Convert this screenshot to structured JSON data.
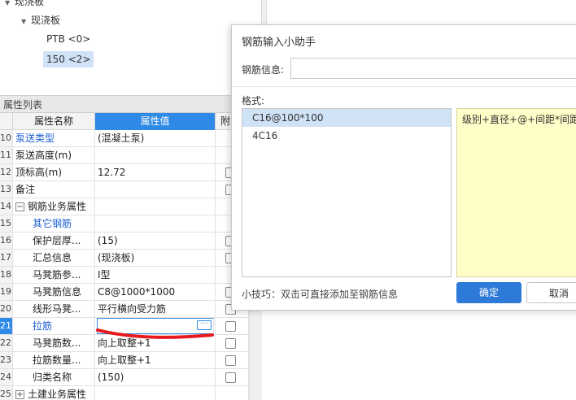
{
  "tree": {
    "items": [
      {
        "label": "现浇板",
        "expanded": true
      },
      {
        "label": "现浇板",
        "expanded": true
      },
      {
        "label": "PTB <0>"
      },
      {
        "label": "150 <2>",
        "selected": true
      }
    ]
  },
  "property_panel": {
    "title": "属性列表",
    "columns": [
      "属性名称",
      "属性值",
      "附"
    ],
    "rows": [
      {
        "num": "10",
        "name": "泵送类型",
        "value": "(混凝土泵)",
        "link": true,
        "check": false
      },
      {
        "num": "11",
        "name": "泵送高度(m)",
        "value": "",
        "check": false
      },
      {
        "num": "12",
        "name": "顶标高(m)",
        "value": "12.72",
        "check": true
      },
      {
        "num": "13",
        "name": "备注",
        "value": "",
        "check": true
      },
      {
        "num": "14",
        "name": "钢筋业务属性",
        "value": "",
        "group": true,
        "toggle": "−",
        "check": false
      },
      {
        "num": "15",
        "name": "其它钢筋",
        "value": "",
        "link": true,
        "check": false
      },
      {
        "num": "16",
        "name": "保护层厚...",
        "value": "(15)",
        "check": true
      },
      {
        "num": "17",
        "name": "汇总信息",
        "value": "(现浇板)",
        "check": true
      },
      {
        "num": "18",
        "name": "马凳筋参...",
        "value": "Ⅰ型",
        "check": false
      },
      {
        "num": "19",
        "name": "马凳筋信息",
        "value": "C8@1000*1000",
        "check": true
      },
      {
        "num": "20",
        "name": "线形马凳...",
        "value": "平行横向受力筋",
        "check": true
      },
      {
        "num": "21",
        "name": "拉筋",
        "value": "",
        "link": true,
        "active": true,
        "check": true
      },
      {
        "num": "22",
        "name": "马凳筋数...",
        "value": "向上取整+1",
        "check": true
      },
      {
        "num": "23",
        "name": "拉筋数量...",
        "value": "向上取整+1",
        "check": true
      },
      {
        "num": "24",
        "name": "归类名称",
        "value": "(150)",
        "check": true
      },
      {
        "num": "25",
        "name": "土建业务属性",
        "value": "",
        "group": true,
        "toggle": "+",
        "check": false
      }
    ],
    "edit_button_label": "···"
  },
  "dialog": {
    "title": "钢筋输入小助手",
    "info_label": "钢筋信息:",
    "info_value": "",
    "format_label": "格式:",
    "formats": [
      {
        "label": "C16@100*100",
        "selected": true
      },
      {
        "label": "4C16"
      }
    ],
    "format_desc": "级别+直径+@+间距*间距,",
    "tip": "小技巧：双击可直接添加至钢筋信息",
    "ok": "确定",
    "cancel": "取消"
  },
  "colors": {
    "accent": "#2e8ae6",
    "ok_button": "#2e7ad8",
    "desc_bg": "#fffec8",
    "annotation": "#e8191e"
  }
}
